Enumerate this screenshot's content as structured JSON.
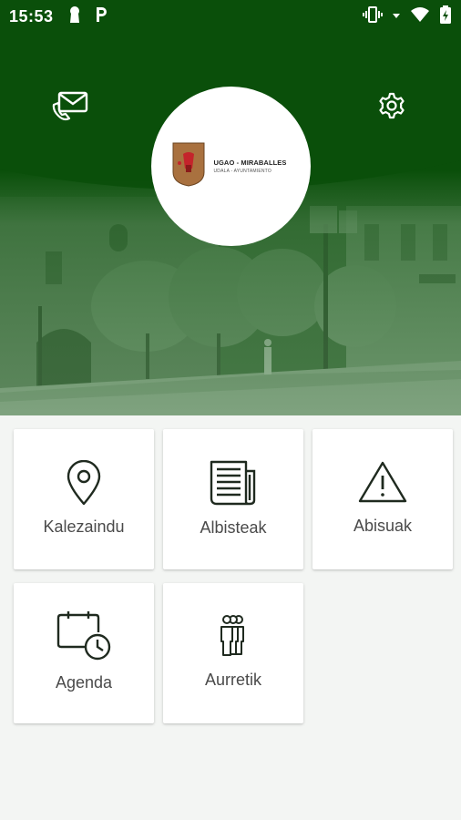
{
  "status_bar": {
    "time": "15:53",
    "left_icons": [
      "keyhole-icon",
      "parking-icon"
    ],
    "right_icons": [
      "vibrate-icon",
      "signal-icon",
      "wifi-icon",
      "battery-icon"
    ]
  },
  "header": {
    "contact_icon": "mail-phone-icon",
    "settings_icon": "gear-icon",
    "logo": {
      "title": "UGAO - MIRABALLES",
      "subtitle": "UDALA - AYUNTAMIENTO"
    }
  },
  "menu": {
    "items": [
      {
        "label": "Kalezaindu",
        "icon": "location-pin-icon"
      },
      {
        "label": "Albisteak",
        "icon": "newspaper-icon"
      },
      {
        "label": "Abisuak",
        "icon": "warning-icon"
      },
      {
        "label": "Agenda",
        "icon": "calendar-clock-icon"
      },
      {
        "label": "Aurretik",
        "icon": "queue-people-icon"
      }
    ]
  },
  "colors": {
    "brand_green": "#0a4f0a",
    "icon_dark": "#1f2a1f",
    "label_gray": "#4a4a4a",
    "background": "#f3f5f3"
  }
}
